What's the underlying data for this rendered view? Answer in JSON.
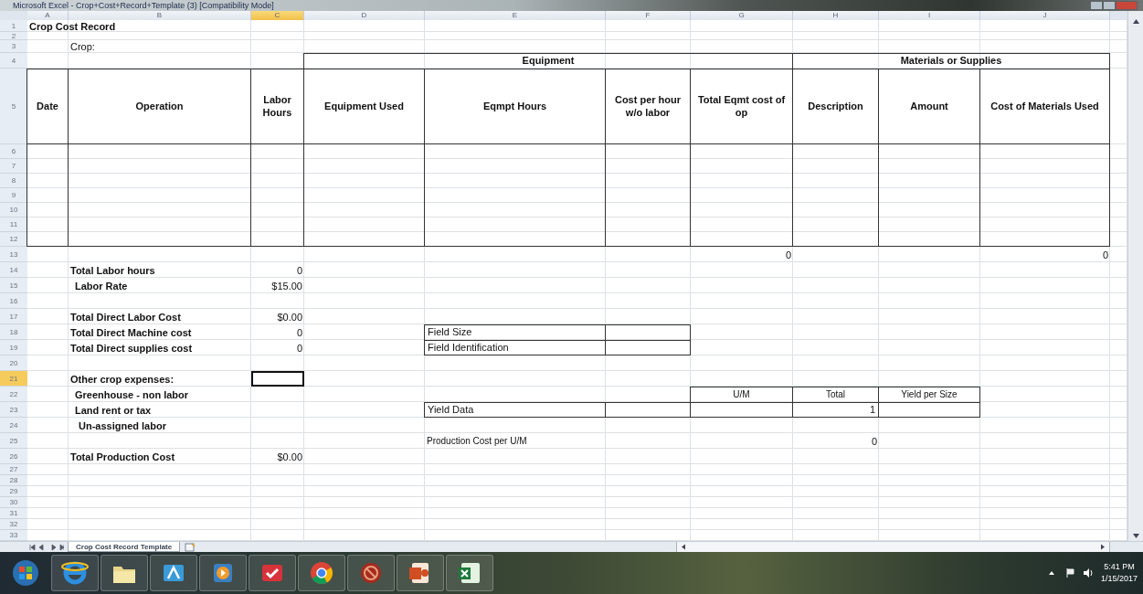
{
  "window": {
    "title": "Microsoft Excel - Crop+Cost+Record+Template (3)  [Compatibility Mode]"
  },
  "column_headers": [
    {
      "label": "A",
      "selected": false
    },
    {
      "label": "B",
      "selected": false
    },
    {
      "label": "C",
      "selected": true
    },
    {
      "label": "D",
      "selected": false
    },
    {
      "label": "E",
      "selected": false
    },
    {
      "label": "F",
      "selected": false
    },
    {
      "label": "G",
      "selected": false
    },
    {
      "label": "H",
      "selected": false
    },
    {
      "label": "I",
      "selected": false
    },
    {
      "label": "J",
      "selected": false
    }
  ],
  "row_headers": [
    {
      "label": "1",
      "selected": false
    },
    {
      "label": "2",
      "selected": false
    },
    {
      "label": "3",
      "selected": false
    },
    {
      "label": "4",
      "selected": false
    },
    {
      "label": "5",
      "selected": false
    },
    {
      "label": "6",
      "selected": false
    },
    {
      "label": "7",
      "selected": false
    },
    {
      "label": "8",
      "selected": false
    },
    {
      "label": "9",
      "selected": false
    },
    {
      "label": "10",
      "selected": false
    },
    {
      "label": "11",
      "selected": false
    },
    {
      "label": "12",
      "selected": false
    },
    {
      "label": "13",
      "selected": false
    },
    {
      "label": "14",
      "selected": false
    },
    {
      "label": "15",
      "selected": false
    },
    {
      "label": "16",
      "selected": false
    },
    {
      "label": "17",
      "selected": false
    },
    {
      "label": "18",
      "selected": false
    },
    {
      "label": "19",
      "selected": false
    },
    {
      "label": "20",
      "selected": false
    },
    {
      "label": "21",
      "selected": true
    },
    {
      "label": "22",
      "selected": false
    },
    {
      "label": "23",
      "selected": false
    },
    {
      "label": "24",
      "selected": false
    },
    {
      "label": "25",
      "selected": false
    },
    {
      "label": "26",
      "selected": false
    },
    {
      "label": "27",
      "selected": false
    },
    {
      "label": "28",
      "selected": false
    },
    {
      "label": "29",
      "selected": false
    },
    {
      "label": "30",
      "selected": false
    },
    {
      "label": "31",
      "selected": false
    },
    {
      "label": "32",
      "selected": false
    },
    {
      "label": "33",
      "selected": false
    }
  ],
  "sheet": {
    "title": "Crop Cost Record",
    "crop_label": "Crop:",
    "groups": [
      {
        "label": "Equipment"
      },
      {
        "label": "Materials or Supplies"
      }
    ],
    "columns": [
      "Date",
      "Operation",
      "Labor Hours",
      "Equipment Used",
      "Eqmpt Hours",
      "Cost per hour w/o labor",
      "Total Eqmt cost of op",
      "Description",
      "Amount",
      "Cost of Materials Used"
    ],
    "column_totals": [
      {
        "value": "0"
      },
      {
        "value": "0"
      }
    ],
    "summary": [
      {
        "kind": "total",
        "label": "Total Labor hours",
        "value": "0",
        "selected": false
      },
      {
        "kind": "sub",
        "label": "Labor Rate",
        "value": "$15.00",
        "selected": false
      },
      {
        "kind": "total",
        "label": "Total Direct Labor Cost",
        "value": "$0.00",
        "selected": false
      },
      {
        "kind": "total",
        "label": "Total Direct Machine cost",
        "value": "0",
        "selected": false
      },
      {
        "kind": "total",
        "label": "Total Direct supplies cost",
        "value": "0",
        "selected": false
      },
      {
        "kind": "total",
        "label": "Other crop expenses:",
        "selected": true
      },
      {
        "kind": "sub",
        "label": "Greenhouse - non labor",
        "selected": false
      },
      {
        "kind": "sub",
        "label": "Land rent or tax",
        "selected": false
      },
      {
        "kind": "subsub",
        "label": "Un-assigned labor",
        "selected": false
      },
      {
        "kind": "total",
        "label": "Total Production Cost",
        "value": "$0.00",
        "selected": false
      }
    ],
    "field_info": [
      {
        "label": "Field Size"
      },
      {
        "label": "Field Identification"
      }
    ],
    "yield_table": {
      "headers": [
        "U/M",
        "Total",
        "Yield per Size"
      ],
      "label": "Yield Data",
      "total": "1"
    },
    "production_cost": {
      "label": "Production Cost per U/M",
      "value": "0"
    }
  },
  "sheet_tabs": [
    {
      "label": "Crop Cost Record Template",
      "selected": true
    }
  ],
  "taskbar": {
    "time": "5:41 PM",
    "date": "1/15/2017"
  }
}
